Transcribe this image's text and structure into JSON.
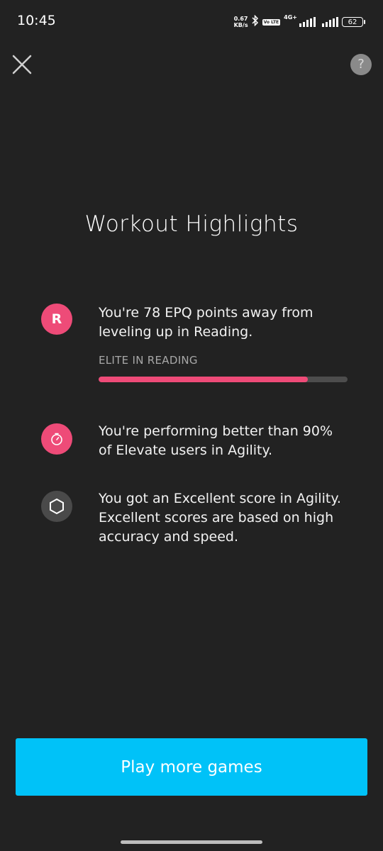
{
  "status_bar": {
    "time": "10:45",
    "net_speed_value": "0.67",
    "net_speed_unit": "KB/s",
    "volte_label": "Vo LTE",
    "network_type": "4G+",
    "battery_level": "62",
    "icons": [
      "bluetooth-icon",
      "signal-icon",
      "signal-icon",
      "battery-icon"
    ]
  },
  "header": {
    "close_icon": "close-icon",
    "help_label": "?"
  },
  "page": {
    "title": "Workout Highlights"
  },
  "highlights": [
    {
      "icon": "reading-badge-icon",
      "badge_letter": "R",
      "text": "You're 78 EPQ points away from leveling up in Reading.",
      "level_label": "ELITE IN READING",
      "progress": 0.84,
      "accent_color": "#ee4b78"
    },
    {
      "icon": "stopwatch-icon",
      "text": "You're performing better than 90% of Elevate users in Agility.",
      "accent_color": "#ee4b78"
    },
    {
      "icon": "hexagon-icon",
      "text": "You got an Excellent score in Agility. Excellent scores are based on high accuracy and speed.",
      "accent_color": "#4a4a4a"
    }
  ],
  "footer": {
    "play_button_label": "Play more games",
    "play_button_color": "#00c2f8"
  }
}
